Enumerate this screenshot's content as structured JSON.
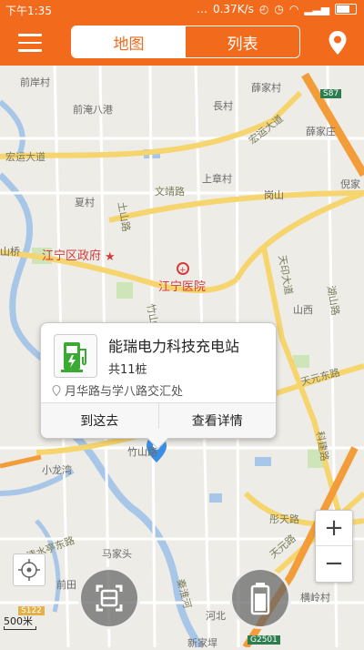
{
  "status_bar": {
    "time": "下午1:35",
    "network_speed": "0.37K/s",
    "battery_level": 0.85
  },
  "nav": {
    "tabs": [
      {
        "label": "地图",
        "active": true
      },
      {
        "label": "列表",
        "active": false
      }
    ],
    "menu_icon": "hamburger-menu-icon",
    "location_icon": "location-pin-icon"
  },
  "map": {
    "labels": [
      "前岸村",
      "薛家村",
      "前淹八港",
      "長村",
      "宏运大道",
      "薛家庄",
      "宏运大道",
      "文靖路",
      "上章村",
      "岗山",
      "夏村",
      "倪家",
      "土山路",
      "江宁区政府",
      "江宁医院",
      "天印大道",
      "山桥",
      "山西",
      "湖山路",
      "竹山路",
      "天元东路",
      "科建路",
      "小龙湾",
      "彤天路",
      "天元路",
      "马家头",
      "清水亭东路",
      "前田",
      "秦淮河",
      "横岭村",
      "河北",
      "新家垾",
      "竹山路"
    ],
    "road_badges": [
      "S87",
      "S122",
      "G2501"
    ]
  },
  "station": {
    "name": "能瑞电力科技充电站",
    "piles": "共11桩",
    "address": "月华路与学八路交汇处",
    "actions": [
      "到这去",
      "查看详情"
    ]
  },
  "controls": {
    "zoom_in": "+",
    "zoom_out": "−",
    "scale_label": "500米"
  },
  "colors": {
    "brand_orange": "#f26a1b",
    "charger_green": "#3aaa35",
    "highway_orange": "#f39c3a",
    "river_blue": "#a8c7e8"
  }
}
